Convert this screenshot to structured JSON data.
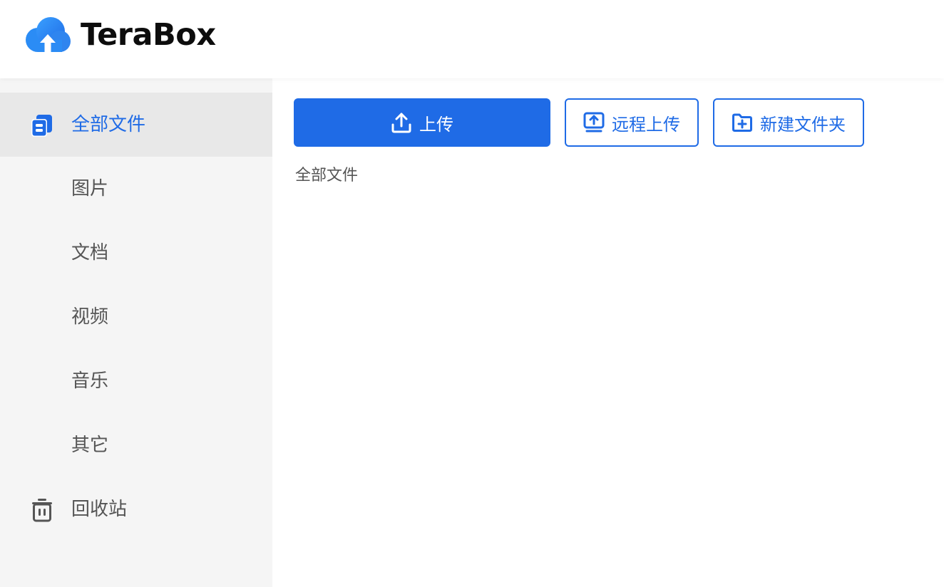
{
  "app": {
    "logo_text": "TeraBox",
    "accent_color": "#1f6be6"
  },
  "sidebar": {
    "items": [
      {
        "label": "全部文件",
        "icon": "files-stack-icon",
        "active": true
      },
      {
        "label": "图片",
        "icon": "",
        "active": false
      },
      {
        "label": "文档",
        "icon": "",
        "active": false
      },
      {
        "label": "视频",
        "icon": "",
        "active": false
      },
      {
        "label": "音乐",
        "icon": "",
        "active": false
      },
      {
        "label": "其它",
        "icon": "",
        "active": false
      },
      {
        "label": "回收站",
        "icon": "trash-icon",
        "active": false
      }
    ]
  },
  "toolbar": {
    "upload_label": "上传",
    "upload_icon": "upload-icon",
    "remote_upload_label": "远程上传",
    "remote_upload_icon": "remote-upload-icon",
    "new_folder_label": "新建文件夹",
    "new_folder_icon": "folder-plus-icon"
  },
  "breadcrumb": {
    "current": "全部文件"
  }
}
